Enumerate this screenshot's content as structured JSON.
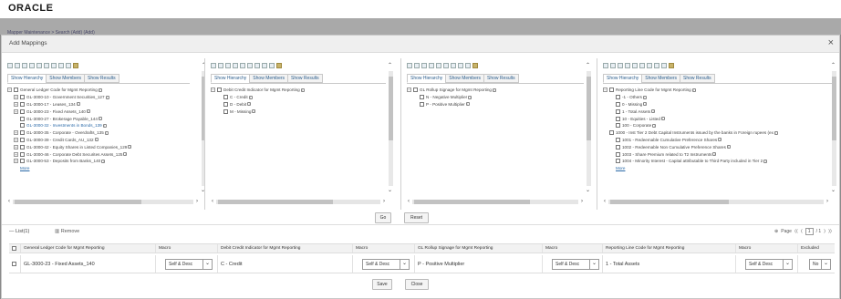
{
  "brand": {
    "logo": "ORACLE"
  },
  "background": {
    "breadcrumb": "Mapper Maintenance  >  Search  (Add)  (Add)"
  },
  "dialog": {
    "title": "Add Mappings",
    "close_icon": "×"
  },
  "tabs": [
    "Show Hierarchy",
    "Show Members",
    "Show Results"
  ],
  "panels": [
    {
      "root": "General Ledger Code for Mgmt Reporting",
      "items": [
        {
          "label": "GL-3000-10 - Government Securities_127",
          "exp": true,
          "hl": false
        },
        {
          "label": "GL-3000-17 - Leases_134",
          "exp": true,
          "hl": false
        },
        {
          "label": "GL-3000-23 - Fixed Assets_140",
          "exp": true,
          "hl": false
        },
        {
          "label": "GL-3000-27 - Brokerage Payable_144",
          "exp": false,
          "hl": false
        },
        {
          "label": "GL-3000-32 - Investments in Bonds_139",
          "exp": false,
          "hl": true
        },
        {
          "label": "GL-3000-35 - Corporate - Overdrafts_135",
          "exp": true,
          "hl": false
        },
        {
          "label": "GL-3000-39 - Credit Cards_AU_132",
          "exp": true,
          "hl": false
        },
        {
          "label": "GL-3000-42 - Equity Shares in Listed Companies_129",
          "exp": true,
          "hl": false
        },
        {
          "label": "GL-3000-46 - Corporate Debt Securites Assets_125",
          "exp": true,
          "hl": false
        },
        {
          "label": "GL-3000-53 - Deposits from Banks_140",
          "exp": true,
          "hl": false
        }
      ],
      "more": "More"
    },
    {
      "root": "Debit Credit Indicator for Mgmt Reporting",
      "items": [
        {
          "label": "C - Credit",
          "exp": false,
          "hl": false
        },
        {
          "label": "D - Debit",
          "exp": false,
          "hl": false
        },
        {
          "label": "M - Missing",
          "exp": false,
          "hl": false
        }
      ],
      "more": ""
    },
    {
      "root": "GL Rollup Signage for Mgmt Reporting",
      "items": [
        {
          "label": "N - Negative Multiplier",
          "exp": false,
          "hl": false
        },
        {
          "label": "P - Positive Multiplier",
          "exp": false,
          "hl": false
        }
      ],
      "more": ""
    },
    {
      "root": "Reporting Line Code for Mgmt Reporting",
      "items": [
        {
          "label": "-1 - Others",
          "exp": false,
          "hl": false
        },
        {
          "label": "0 - Missing",
          "exp": false,
          "hl": false
        },
        {
          "label": "1 - Total Assets",
          "exp": false,
          "hl": false
        },
        {
          "label": "10 - Equities - Listed",
          "exp": false,
          "hl": false
        },
        {
          "label": "100 - Corporate",
          "exp": false,
          "hl": false
        },
        {
          "label": "1000 - Inst Tier 2 Debt Capital Instruments issued by the banks in Foreign rupees (ex",
          "exp": false,
          "hl": false,
          "level": 0
        },
        {
          "label": "1001 - Redeemable Cumulative Preference Shares",
          "exp": false,
          "hl": false
        },
        {
          "label": "1002 - Redeemable Non Cumulative Preference Shares",
          "exp": false,
          "hl": false
        },
        {
          "label": "1003 - Share Premium related to T2 Instruments",
          "exp": false,
          "hl": false
        },
        {
          "label": "1004 - Minority Interest - Capital attributable to Third Party included in Tier 2",
          "exp": false,
          "hl": false
        }
      ],
      "more": "More"
    }
  ],
  "actions": {
    "go": "Go",
    "reset": "Reset"
  },
  "list": {
    "title": "List(1)",
    "remove": "Remove",
    "pager": {
      "page_label": "Page",
      "current": "1",
      "total": "/ 1"
    },
    "columns": [
      "General Ledger Code for Mgmt Reporting",
      "Macro",
      "Debit Credit Indicator for Mgmt Reporting",
      "Macro",
      "GL Rollup Signage for Mgmt Reporting",
      "Macro",
      "Reporting Line Code for Mgmt Reporting",
      "Macro",
      "Excluded"
    ],
    "row": {
      "gl": "GL-3000-23 - Fixed Assets_140",
      "macro1": "Self & Desc",
      "dci": "C - Credit",
      "macro2": "Self & Desc",
      "rollup": "P - Positive Multiplier",
      "macro3": "Self & Desc",
      "rlc": "1 - Total Assets",
      "macro4": "Self & Desc",
      "excluded": "No"
    }
  },
  "footer": {
    "save": "Save",
    "close": "Close"
  }
}
